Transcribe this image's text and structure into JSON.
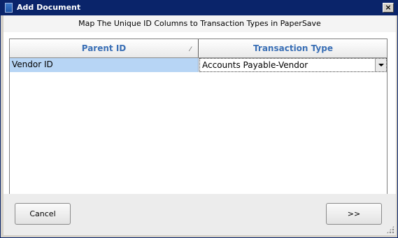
{
  "window": {
    "title": "Add Document",
    "close_glyph": "×"
  },
  "header": {
    "subtitle": "Map The Unique ID Columns to Transaction Types in PaperSave"
  },
  "grid": {
    "columns": [
      "Parent ID",
      "Transaction Type"
    ],
    "sort_glyph": "⁄",
    "rows": [
      {
        "parent_id": "Vendor ID",
        "transaction_type": "Accounts Payable-Vendor"
      }
    ]
  },
  "footer": {
    "cancel_label": "Cancel",
    "next_label": ">>"
  },
  "colors": {
    "header_text": "#3a6fb5",
    "selected_cell": "#b7d5f5",
    "titlebar": "#0a246a"
  },
  "icons": [
    "document-icon",
    "close-icon",
    "sort-icon",
    "dropdown-arrow-icon",
    "size-grip-icon"
  ]
}
